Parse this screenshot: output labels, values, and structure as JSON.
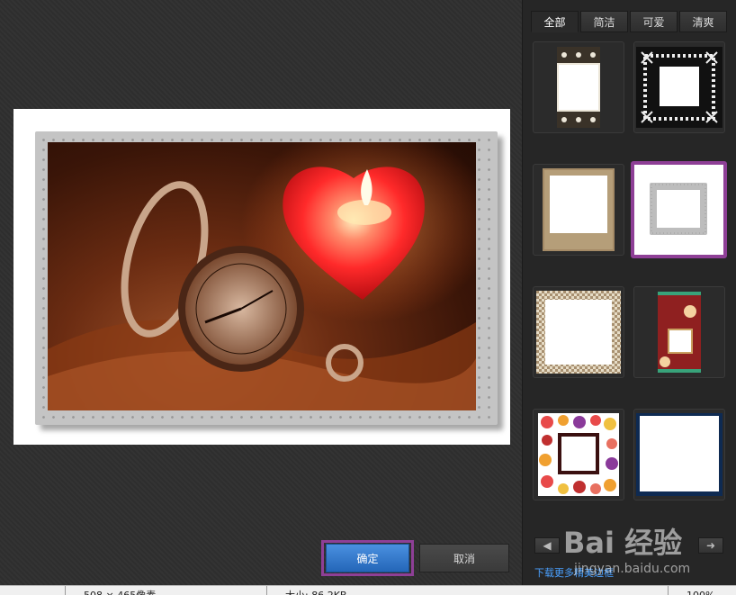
{
  "tabs": [
    {
      "label": "全部",
      "active": true
    },
    {
      "label": "简洁",
      "active": false
    },
    {
      "label": "可爱",
      "active": false
    },
    {
      "label": "清爽",
      "active": false
    }
  ],
  "thumbnails": [
    {
      "name": "damask-frame",
      "selected": false
    },
    {
      "name": "snowflake-lace-frame",
      "selected": false
    },
    {
      "name": "vintage-paper-frame",
      "selected": false
    },
    {
      "name": "silver-dotted-frame",
      "selected": true
    },
    {
      "name": "checkered-frame",
      "selected": false
    },
    {
      "name": "cupcake-frame",
      "selected": false
    },
    {
      "name": "candy-dots-frame",
      "selected": false
    },
    {
      "name": "navy-plain-frame",
      "selected": false
    }
  ],
  "buttons": {
    "ok": "确定",
    "cancel": "取消"
  },
  "more_link": "下载更多精美边框",
  "statusbar": {
    "dimensions": "508 × 465像素",
    "size": "大小: 86.2KB",
    "zoom": "100%"
  },
  "watermark": {
    "brand": "Bai 经验",
    "url": "jingyan.baidu.com"
  },
  "colors": {
    "highlight": "#8e3f96",
    "accent": "#2466b8"
  }
}
